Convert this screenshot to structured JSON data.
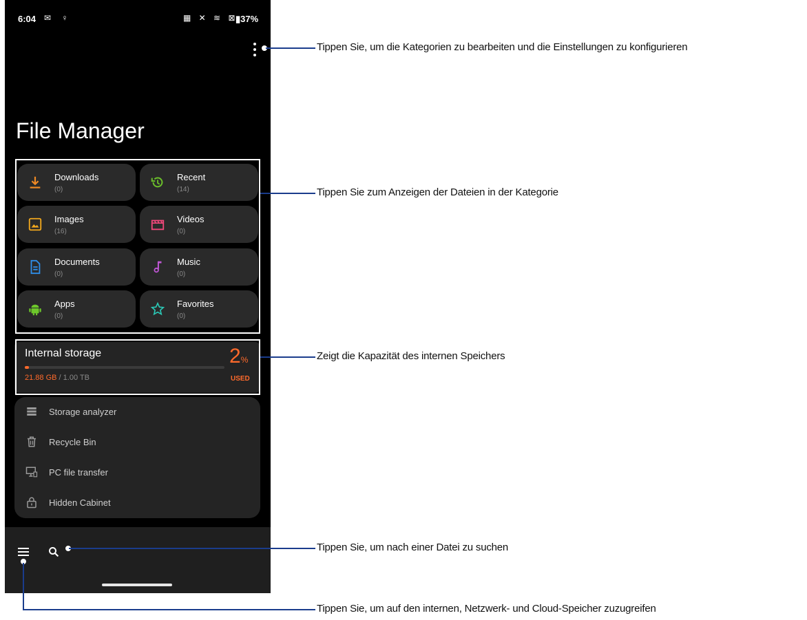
{
  "status_bar": {
    "time": "6:04",
    "battery": "37%"
  },
  "app": {
    "title": "File Manager"
  },
  "categories": [
    {
      "label": "Downloads",
      "count": "(0)",
      "color": "#f08a24"
    },
    {
      "label": "Recent",
      "count": "(14)",
      "color": "#6bbf2a"
    },
    {
      "label": "Images",
      "count": "(16)",
      "color": "#f2a81d"
    },
    {
      "label": "Videos",
      "count": "(0)",
      "color": "#f0487a"
    },
    {
      "label": "Documents",
      "count": "(0)",
      "color": "#2f8fea"
    },
    {
      "label": "Music",
      "count": "(0)",
      "color": "#c057d6"
    },
    {
      "label": "Apps",
      "count": "(0)",
      "color": "#6dc82b"
    },
    {
      "label": "Favorites",
      "count": "(0)",
      "color": "#2bc7b5"
    }
  ],
  "storage": {
    "title": "Internal storage",
    "used": "21.88 GB",
    "total": "/ 1.00 TB",
    "percent": "2",
    "percent_sign": "%",
    "used_label": "USED",
    "fill_fraction": 0.02
  },
  "tools": [
    {
      "label": "Storage analyzer",
      "icon": "storage-analyzer-icon"
    },
    {
      "label": "Recycle Bin",
      "icon": "trash-icon"
    },
    {
      "label": "PC file transfer",
      "icon": "pc-transfer-icon"
    },
    {
      "label": "Hidden Cabinet",
      "icon": "lock-icon"
    }
  ],
  "callouts": {
    "menu": "Tippen Sie, um die Kategorien zu bearbeiten und die Einstellungen zu konfigurieren",
    "categories": "Tippen Sie zum Anzeigen der Dateien in der Kategorie",
    "storage": "Zeigt die Kapazität des internen Speichers",
    "search": "Tippen Sie, um nach einer Datei zu suchen",
    "drawer": "Tippen Sie, um auf den internen, Netzwerk- und Cloud-Speicher zuzugreifen"
  },
  "colors": {
    "accent": "#ff6a2b",
    "callout_line": "#1a3c8c",
    "tile_bg": "#2a2a2a"
  }
}
